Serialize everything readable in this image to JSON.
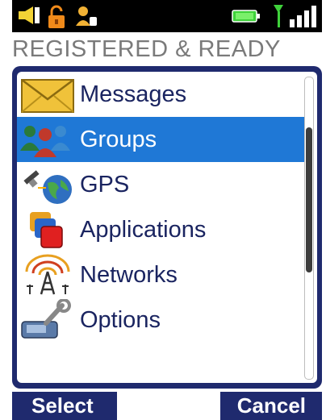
{
  "status_bar": {
    "icons": [
      "speaker-icon",
      "unlocked-padlock-icon",
      "user-status-icon",
      "battery-icon",
      "antenna-icon",
      "signal-bars-icon"
    ],
    "battery_color": "#3fd13b"
  },
  "status_text": "REGISTERED & READY",
  "menu": {
    "selected_index": 1,
    "items": [
      {
        "label": "Messages",
        "icon": "envelope-icon"
      },
      {
        "label": "Groups",
        "icon": "people-group-icon"
      },
      {
        "label": "GPS",
        "icon": "globe-satellite-icon"
      },
      {
        "label": "Applications",
        "icon": "stacked-windows-icon"
      },
      {
        "label": "Networks",
        "icon": "radio-tower-icon"
      },
      {
        "label": "Options",
        "icon": "wrench-tools-icon"
      }
    ]
  },
  "softkeys": {
    "left": "Select",
    "middle": "",
    "right": "Cancel"
  },
  "colors": {
    "panel": "#1f2a6e",
    "selection": "#1f78d6",
    "label": "#1a2460"
  }
}
